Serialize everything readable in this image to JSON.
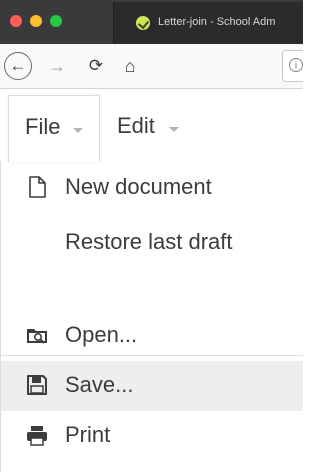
{
  "window": {
    "tab_title": "Letter-join - School Adm",
    "tab_favicon": "letter-join-favicon",
    "traffic_lights": [
      "close",
      "minimize",
      "zoom"
    ]
  },
  "navbar": {
    "back_icon": "←",
    "forward_icon": "→",
    "reload_icon": "⟳",
    "home_icon": "⌂",
    "info_icon": "i"
  },
  "menubar": {
    "file_label": "File",
    "edit_label": "Edit"
  },
  "file_menu": {
    "items": [
      {
        "label": "New document",
        "icon": "new-document-icon"
      },
      {
        "label": "Restore last draft",
        "icon": ""
      },
      {
        "label": "Open...",
        "icon": "open-folder-icon"
      },
      {
        "label": "Save...",
        "icon": "save-floppy-icon",
        "highlighted": true
      },
      {
        "label": "Print",
        "icon": "printer-icon"
      }
    ]
  },
  "colors": {
    "tabstrip": "#3a3a3c",
    "highlight": "#eeeeee",
    "text": "#3c3c3c"
  }
}
